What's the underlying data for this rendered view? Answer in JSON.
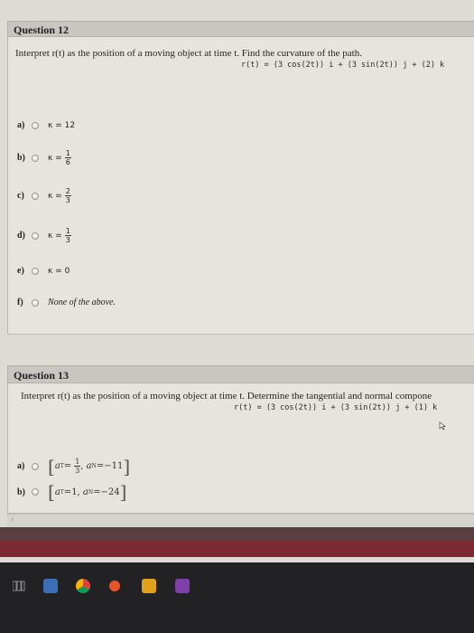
{
  "q12": {
    "header": "Question 12",
    "prompt": "Interpret r(t) as the position of a moving object at time t. Find the curvature of the path.",
    "equation": "r(t) = (3 cos(2t)) i + (3 sin(2t)) j + (2) k",
    "options": [
      {
        "label": "a)",
        "kappa": "κ =",
        "value": "12"
      },
      {
        "label": "b)",
        "kappa": "κ =",
        "num": "1",
        "den": "6"
      },
      {
        "label": "c)",
        "kappa": "κ =",
        "num": "2",
        "den": "3"
      },
      {
        "label": "d)",
        "kappa": "κ =",
        "num": "1",
        "den": "3"
      },
      {
        "label": "e)",
        "kappa": "κ =",
        "value": "0"
      },
      {
        "label": "f)",
        "text": "None of the above."
      }
    ]
  },
  "q13": {
    "header": "Question 13",
    "prompt": "Interpret r(t) as the position of a moving object at time t. Determine the tangential and normal compone",
    "equation": "r(t) = (3 cos(2t)) i + (3 sin(2t)) j + (1) k",
    "options": [
      {
        "label": "a)",
        "aT": "a",
        "aTsub": "T",
        "aTeq": "=",
        "aTnum": "1",
        "aTden": "3",
        "aN": "a",
        "aNsub": "N",
        "aNeq": "=",
        "aNval": "−11"
      },
      {
        "label": "b)",
        "aT": "a",
        "aTsub": "T",
        "aTeq": "=",
        "aTval": "1,",
        "aN": "a",
        "aNsub": "N",
        "aNeq": "=",
        "aNval": "−24"
      }
    ]
  },
  "scroll": {
    "arrow": "‹"
  }
}
